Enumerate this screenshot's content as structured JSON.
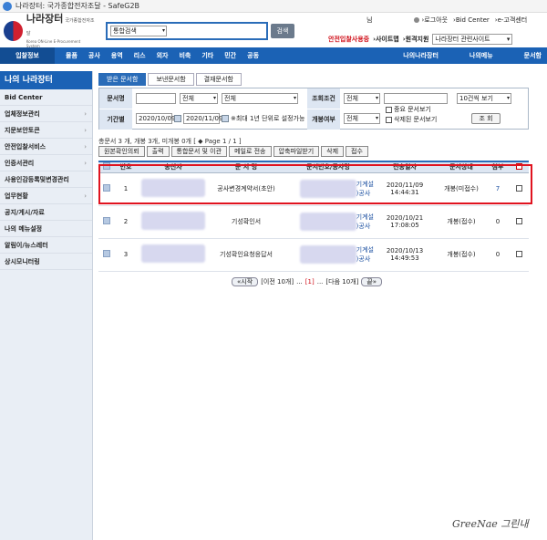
{
  "window": {
    "title": "나라장터: 국가종합전자조달 - SafeG2B"
  },
  "header": {
    "logo_title": "나라장터",
    "logo_sub": "국가종합전자조달",
    "logo_en": "Korea ON-Line E-Procurement System",
    "search_select": "통합검색",
    "search_button": "검색",
    "user_suffix": "님",
    "links": [
      "›로그아웃",
      "›Bid Center",
      "›e-고객센터"
    ],
    "safe_notice": "안전입찰사용중",
    "sitemap": "›사이트맵",
    "remote": "›원격지원",
    "related_select": "나라장터 관련사이트"
  },
  "nav": {
    "home": "입찰정보",
    "items": [
      "물품",
      "공사",
      "용역",
      "리스",
      "외자",
      "비축",
      "기타",
      "민간",
      "공동"
    ],
    "right": [
      "나의나라장터",
      "나의메뉴",
      "문서함"
    ]
  },
  "sidebar": {
    "title": "나의 나라장터",
    "items": [
      {
        "label": "Bid Center",
        "chev": ""
      },
      {
        "label": "업체정보관리",
        "chev": "›"
      },
      {
        "label": "지문보안토큰",
        "chev": "›"
      },
      {
        "label": "안전입찰서비스",
        "chev": "›"
      },
      {
        "label": "인증서관리",
        "chev": "›"
      },
      {
        "label": "사용인감등록및변경관리",
        "chev": ""
      },
      {
        "label": "업무현황",
        "chev": "›"
      },
      {
        "label": "공지/게시/자료",
        "chev": ""
      },
      {
        "label": "나의 메뉴설정",
        "chev": ""
      },
      {
        "label": "알림이/뉴스레터",
        "chev": ""
      },
      {
        "label": "상시모니터링",
        "chev": ""
      }
    ]
  },
  "tabs": [
    "받은 문서함",
    "보낸문서함",
    "결재문서함"
  ],
  "filter": {
    "doc_name_label": "문서명",
    "all1": "전체",
    "all2": "전체",
    "cond_label": "조회조건",
    "all3": "전체",
    "page_size": "10건씩 보기",
    "period_label": "기간별",
    "date_from": "2020/10/09",
    "date_to": "2020/11/09",
    "period_note": "※최대 1년 단위로 설정가능",
    "open_label": "개봉여부",
    "all4": "전체",
    "important": "중요 문서보기",
    "deleted": "삭제된 문서보기",
    "search": "조 회"
  },
  "summary": "총문서 3 개, 개봉 3개, 미개봉 0개 [ ◆ Page 1 / 1 ]",
  "actions": [
    "원본확인의뢰",
    "출력",
    "통합문서 및 이관",
    "메일로 전송",
    "압축파일받기",
    "삭제",
    "접수"
  ],
  "table": {
    "headers": [
      "번호",
      "송신자",
      "문 서 명",
      "문서번호/공사명",
      "전송일자",
      "문서상태",
      "첨부"
    ],
    "rows": [
      {
        "no": "1",
        "title": "공사변경계약서(초안)",
        "ref": "기계설\n)공사",
        "date": "2020/11/09 14:44:31",
        "status": "개봉(미접수)",
        "attach": "7"
      },
      {
        "no": "2",
        "title": "기성확인서",
        "ref": "기계설\n)공사",
        "date": "2020/10/21 17:08:05",
        "status": "개봉(접수)",
        "attach": "0"
      },
      {
        "no": "3",
        "title": "기성확인요청응답서",
        "ref": "기계설\n)공사",
        "date": "2020/10/13 14:49:53",
        "status": "개봉(접수)",
        "attach": "0"
      }
    ]
  },
  "pager": {
    "first": "시작",
    "prev": "[이전 10개]",
    "ellipsis1": "...",
    "current": "[1]",
    "ellipsis2": "...",
    "next": "[다음 10개]",
    "last": "끝"
  },
  "watermark": "GreeNae 그린내",
  "colors": {
    "nav": "#1b62b5",
    "highlight": "#e0131f"
  }
}
